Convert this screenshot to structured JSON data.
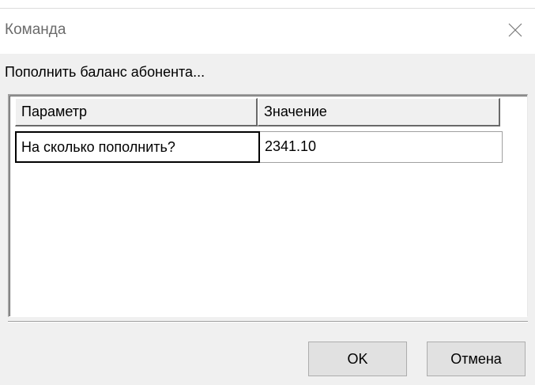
{
  "window": {
    "title": "Команда",
    "close_icon": "close-icon"
  },
  "caption": "Пополнить баланс абонента...",
  "grid": {
    "columns": [
      "Параметр",
      "Значение"
    ],
    "rows": [
      [
        "На сколько пополнить?",
        "2341.10"
      ]
    ]
  },
  "buttons": {
    "ok_label": "OK",
    "cancel_label": "Отмена"
  }
}
